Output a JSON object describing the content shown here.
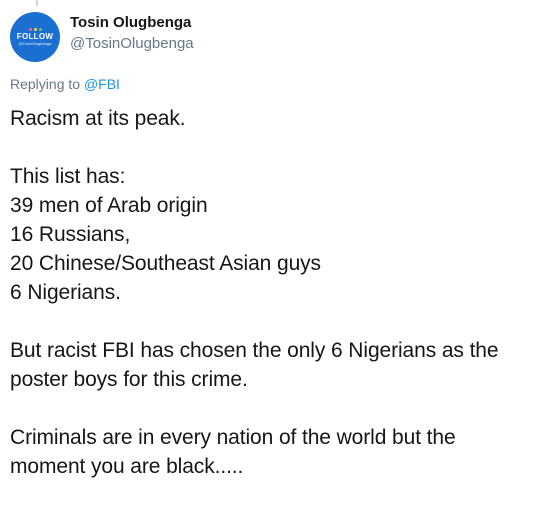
{
  "author": {
    "display_name": "Tosin Olugbenga",
    "handle": "@TosinOlugbenga",
    "avatar": {
      "main_text": "FOLLOW",
      "sub_text": "@TosinOlugbenga",
      "background": "#1a6fd0"
    }
  },
  "reply": {
    "prefix": "Replying to",
    "mention": "@FBI"
  },
  "tweet": {
    "lines": [
      "Racism at its peak.",
      "",
      "This list has:",
      "39 men of Arab origin",
      "16 Russians,",
      "20 Chinese/Southeast Asian guys",
      "6 Nigerians.",
      "",
      "But racist FBI has chosen the only 6 Nigerians as the",
      "poster boys for this crime.",
      "",
      "Criminals are in every nation of the world but the",
      "moment you are black....."
    ]
  },
  "colors": {
    "text": "#14171a",
    "secondary": "#657786",
    "link": "#1b95e0"
  }
}
